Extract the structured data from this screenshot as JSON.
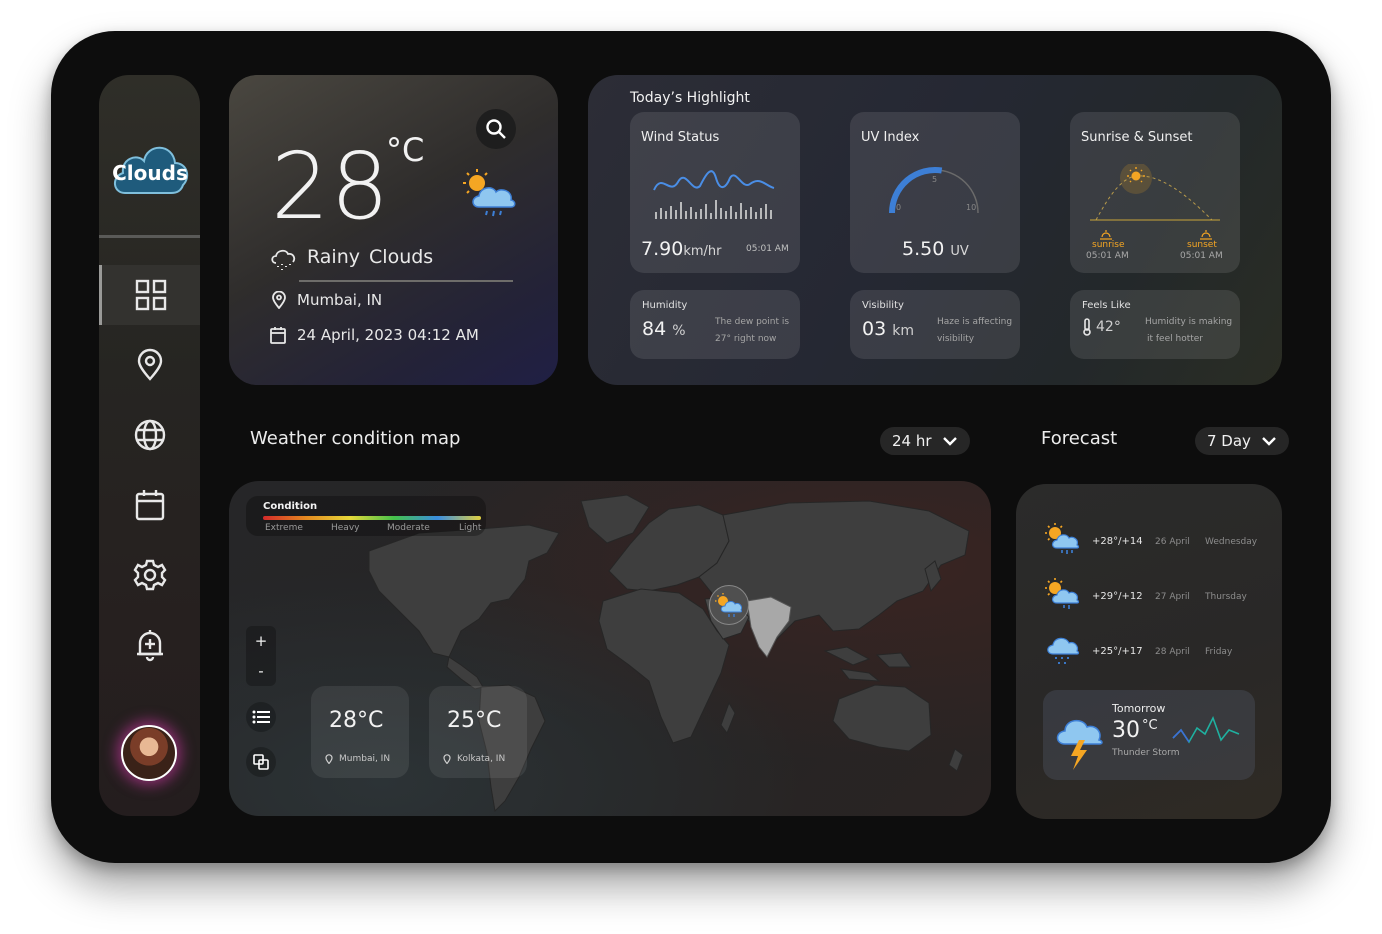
{
  "brand": {
    "logo_text": "Clouds"
  },
  "sidebar": {
    "items": [
      {
        "name": "dashboard",
        "icon": "grid-icon",
        "active": true
      },
      {
        "name": "location",
        "icon": "map-pin-icon"
      },
      {
        "name": "globe",
        "icon": "globe-icon"
      },
      {
        "name": "calendar",
        "icon": "calendar-icon"
      },
      {
        "name": "settings",
        "icon": "gear-icon"
      },
      {
        "name": "notifications",
        "icon": "bell-icon"
      }
    ]
  },
  "current": {
    "temperature": "28",
    "unit": "°C",
    "condition": "Rainy Clouds",
    "location": "Mumbai, IN",
    "datetime": "24 April, 2023 04:12 AM"
  },
  "highlights": {
    "title": "Today’s Highlight",
    "wind": {
      "label": "Wind Status",
      "value": "7.90",
      "unit": "km/hr",
      "time": "05:01 AM"
    },
    "uv": {
      "label": "UV Index",
      "value": "5.50",
      "unit": "UV",
      "scale_min": "0",
      "scale_mid": "5",
      "scale_max": "10",
      "level": 0.55
    },
    "sun": {
      "label": "Sunrise & Sunset",
      "sunrise_label": "sunrise",
      "sunrise_time": "05:01 AM",
      "sunset_label": "sunset",
      "sunset_time": "05:01 AM"
    },
    "humidity": {
      "label": "Humidity",
      "value": "84",
      "unit": "%",
      "note_1": "The dew point is",
      "note_2": "27° right now"
    },
    "visibility": {
      "label": "Visibility",
      "value": "03",
      "unit": "km",
      "note_1": "Haze is affecting",
      "note_2": "visibility"
    },
    "feels_like": {
      "label": "Feels Like",
      "value": "42°",
      "note_1": "Humidity is making",
      "note_2": "it feel hotter"
    }
  },
  "map": {
    "title": "Weather condition map",
    "range": "24 hr",
    "legend": {
      "title": "Condition",
      "labels": [
        "Extreme",
        "Heavy",
        "Moderate",
        "Light"
      ]
    },
    "zoom_in": "+",
    "zoom_out": "-",
    "cities": [
      {
        "temp": "28°C",
        "name": "Mumbai, IN"
      },
      {
        "temp": "25°C",
        "name": "Kolkata, IN"
      }
    ]
  },
  "forecast": {
    "title": "Forecast",
    "range": "7 Day",
    "days": [
      {
        "temp": "+28°/+14",
        "date": "26 April",
        "day": "Wednesday",
        "icon": "sun-cloud-rain-icon"
      },
      {
        "temp": "+29°/+12",
        "date": "27 April",
        "day": "Thursday",
        "icon": "sun-cloud-rain-icon"
      },
      {
        "temp": "+25°/+17",
        "date": "28 April",
        "day": "Friday",
        "icon": "cloud-rain-icon"
      }
    ],
    "tomorrow": {
      "label": "Tomorrow",
      "temp": "30",
      "unit": "°C",
      "condition": "Thunder Storm",
      "icon": "thunderstorm-icon"
    }
  },
  "colors": {
    "accent_blue": "#3d7fd6",
    "sun_yellow": "#f5a623",
    "tomorrow_line": "#1fb0a0"
  }
}
